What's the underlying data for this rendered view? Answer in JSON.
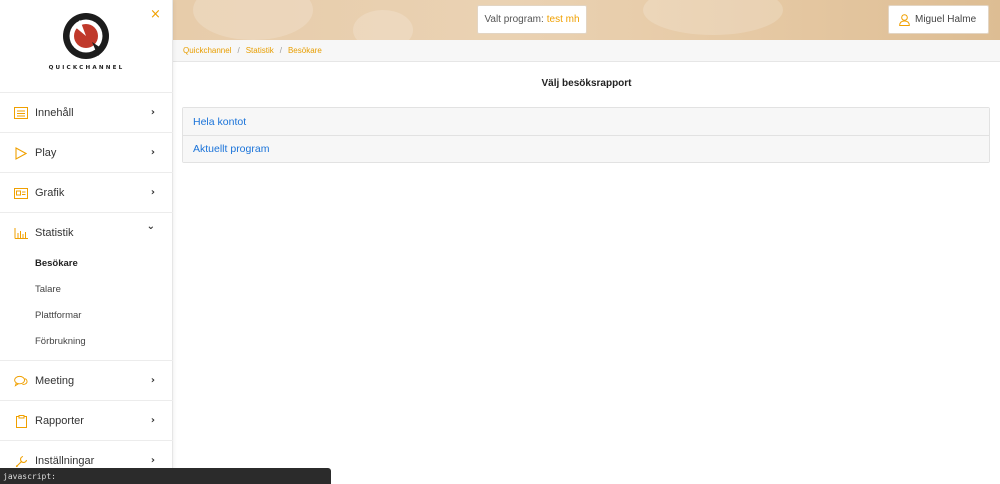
{
  "brand": {
    "name": "QUICKCHANNEL"
  },
  "sidebar": {
    "items": [
      {
        "label": "Innehåll",
        "icon": "list-icon",
        "chevron": "›"
      },
      {
        "label": "Play",
        "icon": "play-icon",
        "chevron": "›"
      },
      {
        "label": "Grafik",
        "icon": "image-icon",
        "chevron": "›"
      },
      {
        "label": "Statistik",
        "icon": "bar-chart-icon",
        "chevron": "⌄",
        "subitems": [
          "Besökare",
          "Talare",
          "Plattformar",
          "Förbrukning"
        ]
      },
      {
        "label": "Meeting",
        "icon": "chat-icon",
        "chevron": "›"
      },
      {
        "label": "Rapporter",
        "icon": "clipboard-icon",
        "chevron": "›"
      },
      {
        "label": "Inställningar",
        "icon": "wrench-icon",
        "chevron": "›"
      }
    ],
    "close": "×"
  },
  "header": {
    "program_label": "Valt program:",
    "program_value": "test mh",
    "user_name": "Miguel Halme"
  },
  "breadcrumb": [
    "Quickchannel",
    "Statistik",
    "Besökare"
  ],
  "main": {
    "title": "Välj besöksrapport",
    "reports": [
      "Hela kontot",
      "Aktuellt program"
    ]
  },
  "statusbar": {
    "text": "javascript:"
  },
  "colors": {
    "accent": "#f0a000",
    "link": "#1a73d9"
  }
}
